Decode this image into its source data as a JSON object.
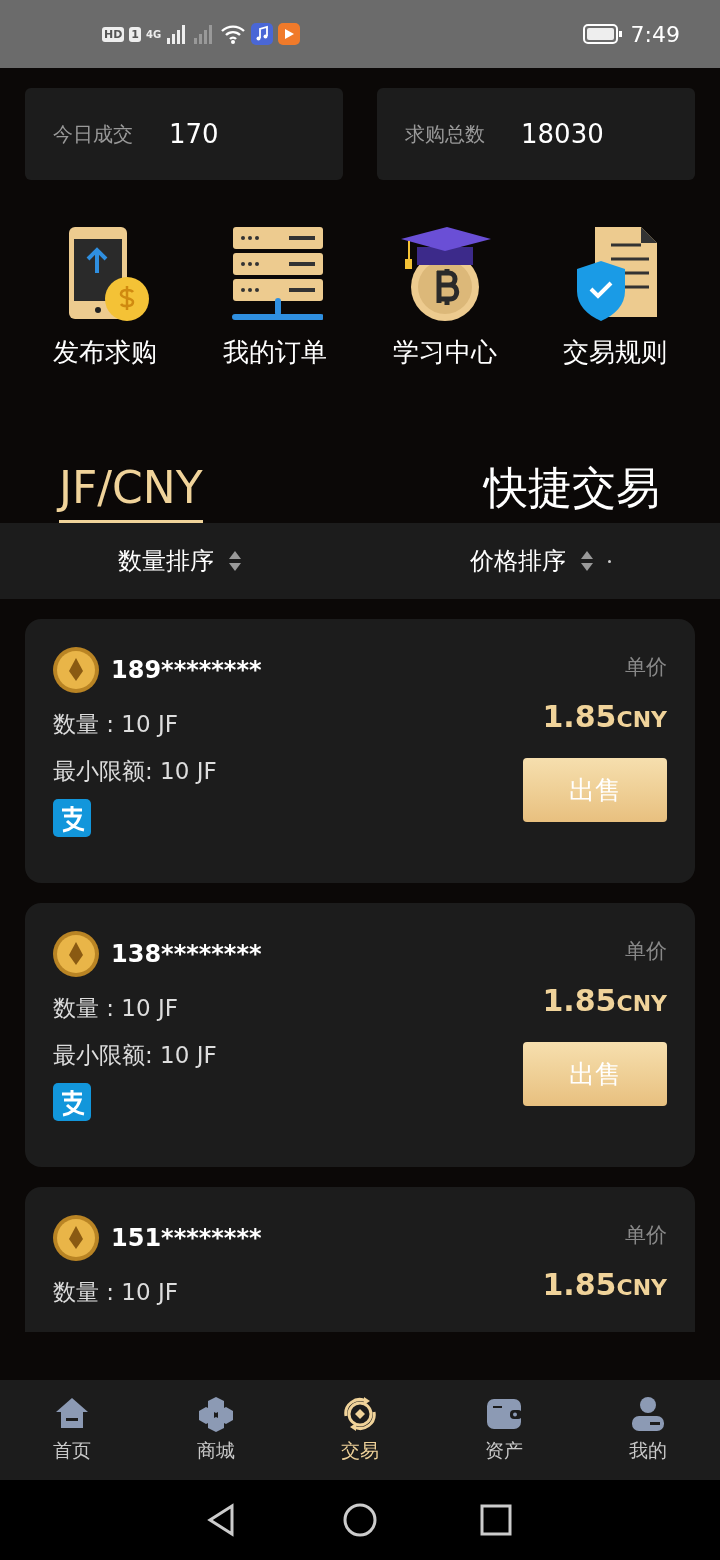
{
  "status_bar": {
    "badges": [
      "HD",
      "1",
      "4G"
    ],
    "time": "7:49"
  },
  "stats": [
    {
      "label": "今日成交",
      "value": "170"
    },
    {
      "label": "求购总数",
      "value": "18030"
    }
  ],
  "shortcuts": [
    {
      "kind": "publish",
      "label": "发布求购"
    },
    {
      "kind": "orders",
      "label": "我的订单"
    },
    {
      "kind": "learn",
      "label": "学习中心"
    },
    {
      "kind": "rules",
      "label": "交易规则"
    }
  ],
  "tabs": [
    {
      "label": "JF/CNY",
      "selected": true
    },
    {
      "label": "快捷交易",
      "selected": false
    }
  ],
  "sort_options": [
    {
      "label": "数量排序",
      "marker": false
    },
    {
      "label": "价格排序",
      "marker": true
    }
  ],
  "offers": [
    {
      "user": "189********",
      "unit_label": "单价",
      "quantity": "数量 : 10 JF",
      "min_limit": "最小限额: 10 JF",
      "price": "1.85",
      "currency": "CNY",
      "payment": {
        "kind": "alipay"
      },
      "action": "出售"
    },
    {
      "user": "138********",
      "unit_label": "单价",
      "quantity": "数量 : 10 JF",
      "min_limit": "最小限额: 10 JF",
      "price": "1.85",
      "currency": "CNY",
      "payment": {
        "kind": "alipay"
      },
      "action": "出售"
    },
    {
      "user": "151********",
      "unit_label": "单价",
      "quantity": "数量 : 10 JF",
      "price": "1.85",
      "currency": "CNY"
    }
  ],
  "bottom_nav": [
    {
      "kind": "home",
      "label": "首页",
      "selected": false
    },
    {
      "kind": "mall",
      "label": "商城",
      "selected": false
    },
    {
      "kind": "trade",
      "label": "交易",
      "selected": true
    },
    {
      "kind": "assets",
      "label": "资产",
      "selected": false
    },
    {
      "kind": "profile",
      "label": "我的",
      "selected": false
    }
  ]
}
